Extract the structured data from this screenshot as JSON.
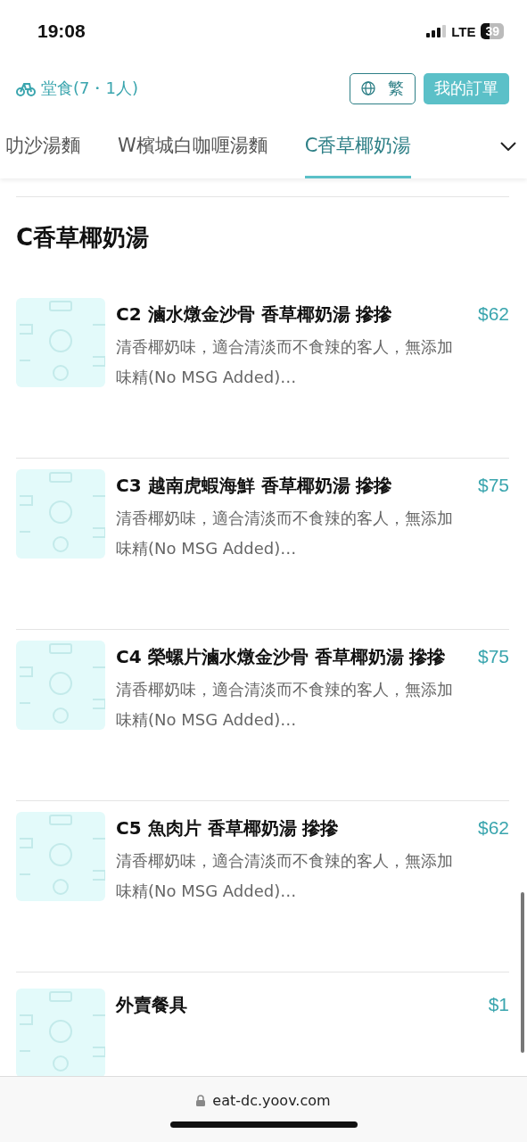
{
  "status_bar": {
    "time": "19:08",
    "network": "LTE",
    "battery": "39"
  },
  "header": {
    "dine_mode": "堂食(7・1人)",
    "language_button": "繁",
    "orders_button": "我的訂單"
  },
  "tabs": [
    {
      "label": "叻沙湯麵",
      "selected": false
    },
    {
      "label": "W檳城白咖喱湯麵",
      "selected": false
    },
    {
      "label": "C香草椰奶湯",
      "selected": true
    }
  ],
  "section": {
    "title": "C香草椰奶湯"
  },
  "items": [
    {
      "name": "C2 滷水燉金沙骨 香草椰奶湯 摻摻",
      "description": "清香椰奶味，適合清淡而不食辣的客人，無添加味精(No MSG Added)…",
      "price": "$62"
    },
    {
      "name": "C3 越南虎蝦海鮮 香草椰奶湯 摻摻",
      "description": "清香椰奶味，適合清淡而不食辣的客人，無添加味精(No MSG Added)…",
      "price": "$75"
    },
    {
      "name": "C4 榮螺片滷水燉金沙骨 香草椰奶湯 摻摻",
      "description": "清香椰奶味，適合清淡而不食辣的客人，無添加味精(No MSG Added)…",
      "price": "$75"
    },
    {
      "name": "C5 魚肉片 香草椰奶湯 摻摻",
      "description": "清香椰奶味，適合清淡而不食辣的客人，無添加味精(No MSG Added)…",
      "price": "$62"
    },
    {
      "name": "外賣餐具",
      "price": "$1"
    }
  ],
  "browser": {
    "url": "eat-dc.yoov.com"
  }
}
